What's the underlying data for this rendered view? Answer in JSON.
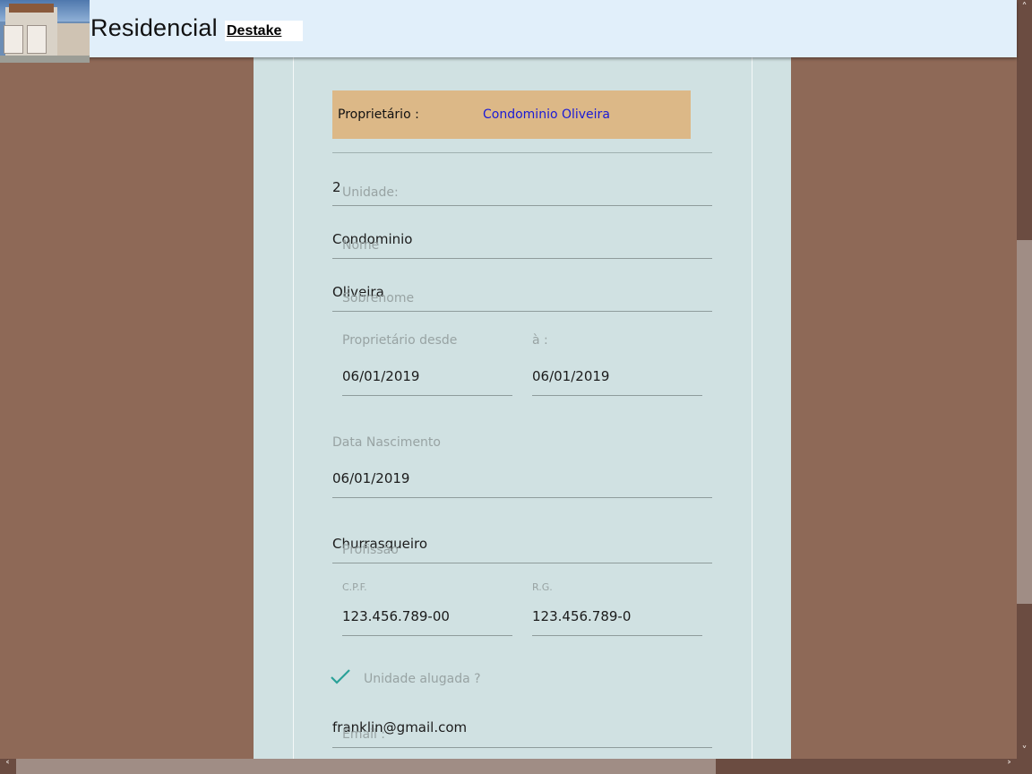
{
  "header": {
    "title": "Residencial",
    "brand": "Destake"
  },
  "owner": {
    "label": "Proprietário :",
    "name": "Condominio Oliveira"
  },
  "form": {
    "unidade": {
      "label": "Unidade:",
      "value": "2"
    },
    "nome": {
      "label": "Nome",
      "value": "Condominio"
    },
    "sobrenome": {
      "label": "Sobrenome",
      "value": "Oliveira"
    },
    "proprietario_desde": {
      "label": "Proprietário desde",
      "value": "06/01/2019"
    },
    "proprietario_ate": {
      "label": "à :",
      "value": "06/01/2019"
    },
    "data_nascimento": {
      "label": "Data Nascimento",
      "value": "06/01/2019"
    },
    "profissao": {
      "label": "Profissão",
      "value": "Churrasqueiro"
    },
    "cpf": {
      "label": "C.P.F.",
      "value": "123.456.789-00"
    },
    "rg": {
      "label": "R.G.",
      "value": "123.456.789-0"
    },
    "alugada": {
      "label": "Unidade alugada ?",
      "checked": true
    },
    "email": {
      "label": "Email :",
      "value": "franklin@gmail.com"
    }
  },
  "colors": {
    "background": "#8e6957",
    "header": "#e1effa",
    "panel": "#d0e1e2",
    "owner_box": "#dcb887",
    "owner_link": "#1a1ad6",
    "check": "#2aa198"
  },
  "icons": {
    "checkmark": "checkmark-icon",
    "scroll_up": "chevron-up-icon",
    "scroll_down": "chevron-down-icon",
    "scroll_left": "chevron-left-icon",
    "scroll_right": "chevron-right-icon"
  }
}
